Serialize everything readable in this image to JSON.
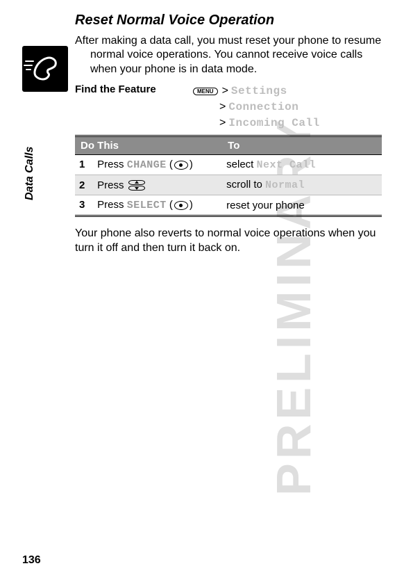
{
  "watermark": "PRELIMINARY",
  "tab_label": "Data Calls",
  "page_number": "136",
  "section": {
    "title": "Reset Normal Voice Operation",
    "intro": "After making a data call, you must reset your phone to resume normal voice operations. You cannot receive voice calls when your phone is in data mode.",
    "closing": "Your phone also reverts to normal voice operations when you turn it off and then turn it back on."
  },
  "feature": {
    "label": "Find the Feature",
    "menu_key": "MENU",
    "path": {
      "a": "Settings",
      "b": "Connection",
      "c": "Incoming Call"
    }
  },
  "table": {
    "headers": {
      "c1": "Do This",
      "c2": "To"
    },
    "rows": [
      {
        "num": "1",
        "action_prefix": "Press ",
        "action_lcd": "CHANGE",
        "action_suffix_open": " (",
        "action_suffix_close": ")",
        "key": "soft",
        "result_prefix": "select ",
        "result_lcd": "Next Call"
      },
      {
        "num": "2",
        "action_prefix": "Press ",
        "key": "scroll",
        "result_prefix": "scroll to ",
        "result_lcd": "Normal"
      },
      {
        "num": "3",
        "action_prefix": "Press ",
        "action_lcd": "SELECT",
        "action_suffix_open": " (",
        "action_suffix_close": ")",
        "key": "soft",
        "result_prefix": "reset your phone"
      }
    ]
  }
}
